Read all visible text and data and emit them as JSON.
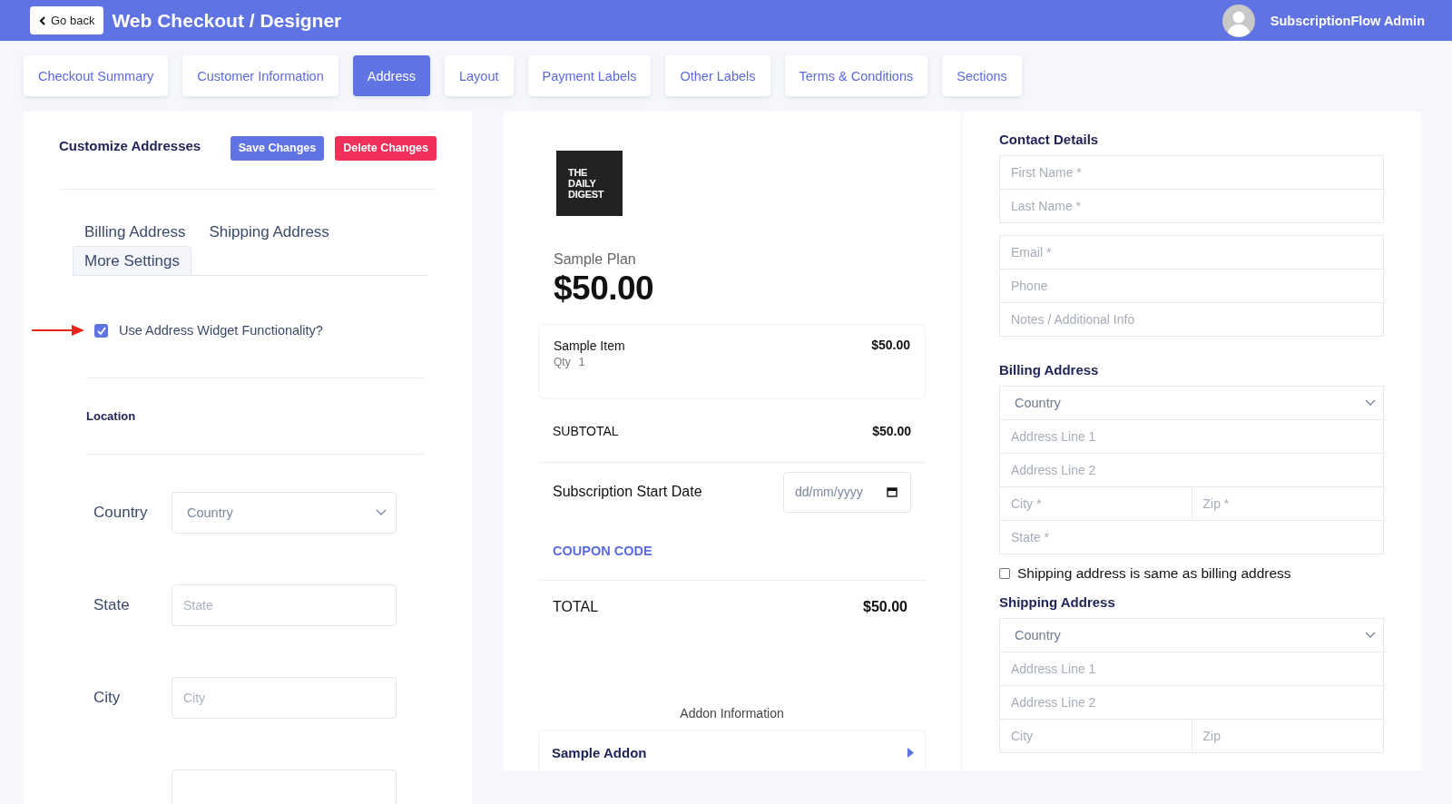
{
  "header": {
    "back_button": "Go back",
    "title": "Web Checkout / Designer",
    "user": "SubscriptionFlow Admin"
  },
  "tabs": [
    {
      "label": "Checkout Summary",
      "selected": false
    },
    {
      "label": "Customer Information",
      "selected": false
    },
    {
      "label": "Address",
      "selected": true
    },
    {
      "label": "Layout",
      "selected": false
    },
    {
      "label": "Payment Labels",
      "selected": false
    },
    {
      "label": "Other Labels",
      "selected": false
    },
    {
      "label": "Terms & Conditions",
      "selected": false
    },
    {
      "label": "Sections",
      "selected": false
    }
  ],
  "settings_panel": {
    "title": "Customize Addresses",
    "buttons": [
      {
        "label": "Save Changes",
        "kind": "primary"
      },
      {
        "label": "Delete Changes",
        "kind": "danger"
      }
    ],
    "subtabs": [
      {
        "label": "Billing Address",
        "selected": false
      },
      {
        "label": "Shipping Address",
        "selected": false
      },
      {
        "label": "More Settings",
        "selected": true
      }
    ],
    "widget_option": {
      "label": "Use Address Widget Functionality?",
      "checked": true
    },
    "section_title": "Location",
    "fields": [
      {
        "label": "Country",
        "kind": "select",
        "value": "Country"
      },
      {
        "label": "State",
        "kind": "input",
        "placeholder": "State"
      },
      {
        "label": "City",
        "kind": "input",
        "placeholder": "City"
      },
      {
        "kind": "input"
      }
    ]
  },
  "preview": {
    "logo": "THE DAILY DIGEST",
    "plan": "Sample Plan",
    "price": "$50.00",
    "item": {
      "name": "Sample Item",
      "qty_label": "Qty",
      "qty": "1",
      "price": "$50.00"
    },
    "subtotal": {
      "label": "SUBTOTAL",
      "value": "$50.00"
    },
    "start_date": {
      "label": "Subscription Start Date",
      "placeholder": "dd/mm/yyyy"
    },
    "coupon": "COUPON CODE",
    "total": {
      "label": "TOTAL",
      "value": "$50.00"
    },
    "addon_heading": "Addon Information",
    "addon": "Sample Addon"
  },
  "form": [
    {
      "kind": "heading",
      "text": "Contact Details"
    },
    {
      "kind": "fields",
      "rows": [
        [
          {
            "kind": "input",
            "placeholder": "First Name *"
          }
        ],
        [
          {
            "kind": "input",
            "placeholder": "Last Name *"
          }
        ]
      ]
    },
    {
      "kind": "fields",
      "rows": [
        [
          {
            "kind": "input",
            "placeholder": "Email *"
          }
        ],
        [
          {
            "kind": "input",
            "placeholder": "Phone"
          }
        ],
        [
          {
            "kind": "input",
            "placeholder": "Notes / Additional Info"
          }
        ]
      ]
    },
    {
      "kind": "heading",
      "text": "Billing Address"
    },
    {
      "kind": "fields",
      "rows": [
        [
          {
            "kind": "select",
            "value": "Country"
          }
        ],
        [
          {
            "kind": "input",
            "placeholder": "Address Line 1"
          }
        ],
        [
          {
            "kind": "input",
            "placeholder": "Address Line 2"
          }
        ],
        [
          {
            "kind": "input",
            "placeholder": "City *"
          },
          {
            "kind": "input",
            "placeholder": "Zip *"
          }
        ],
        [
          {
            "kind": "input",
            "placeholder": "State *"
          }
        ]
      ]
    },
    {
      "kind": "checkbox",
      "label": "Shipping address is same as billing address",
      "checked": false
    },
    {
      "kind": "heading",
      "text": "Shipping Address"
    },
    {
      "kind": "fields",
      "rows": [
        [
          {
            "kind": "select",
            "value": "Country"
          }
        ],
        [
          {
            "kind": "input",
            "placeholder": "Address Line 1"
          }
        ],
        [
          {
            "kind": "input",
            "placeholder": "Address Line 2"
          }
        ],
        [
          {
            "kind": "input",
            "placeholder": "City"
          },
          {
            "kind": "input",
            "placeholder": "Zip"
          }
        ]
      ]
    }
  ]
}
